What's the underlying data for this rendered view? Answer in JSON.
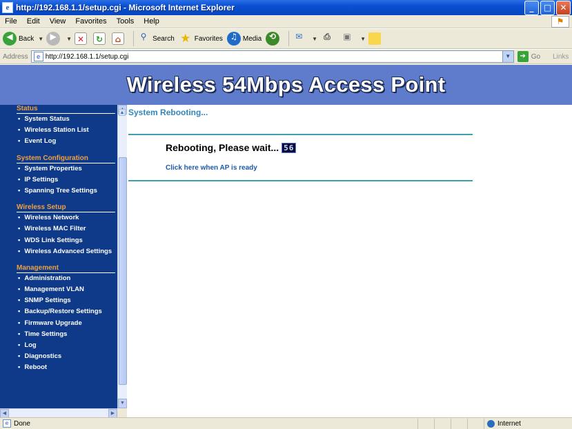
{
  "window": {
    "title": "http://192.168.1.1/setup.cgi - Microsoft Internet Explorer",
    "app_icon": "e",
    "minimize": "_",
    "maximize": "□",
    "close": "✕"
  },
  "menu": [
    "File",
    "Edit",
    "View",
    "Favorites",
    "Tools",
    "Help"
  ],
  "toolbar": {
    "back_label": "Back",
    "search_label": "Search",
    "favorites_label": "Favorites",
    "media_label": "Media"
  },
  "address": {
    "label": "Address",
    "url": "http://192.168.1.1/setup.cgi",
    "go_label": "Go",
    "links_label": "Links"
  },
  "banner": {
    "title": "Wireless 54Mbps Access Point"
  },
  "sidebar": {
    "sections": [
      {
        "heading": "Status",
        "items": [
          "System Status",
          "Wireless Station List",
          "Event Log"
        ]
      },
      {
        "heading": "System Configuration",
        "items": [
          "System Properties",
          "IP Settings",
          "Spanning Tree Settings"
        ]
      },
      {
        "heading": "Wireless Setup",
        "items": [
          "Wireless Network",
          "Wireless MAC Filter",
          "WDS Link Settings",
          "Wireless Advanced Settings"
        ]
      },
      {
        "heading": "Management",
        "items": [
          "Administration",
          "Management VLAN",
          "SNMP Settings",
          "Backup/Restore Settings",
          "Firmware Upgrade",
          "Time Settings",
          "Log",
          "Diagnostics",
          "Reboot"
        ]
      }
    ]
  },
  "main": {
    "header": "System Rebooting...",
    "message": "Rebooting, Please wait...",
    "counter": "56",
    "ready_link": "Click here when AP is ready"
  },
  "status": {
    "left": "Done",
    "zone": "Internet"
  },
  "colors": {
    "banner_bg": "#5f7ccc",
    "sidebar_bg": "#0f3a8a",
    "section_heading": "#f0a040",
    "main_header": "#3187b8",
    "rule": "#3ca0b0"
  }
}
